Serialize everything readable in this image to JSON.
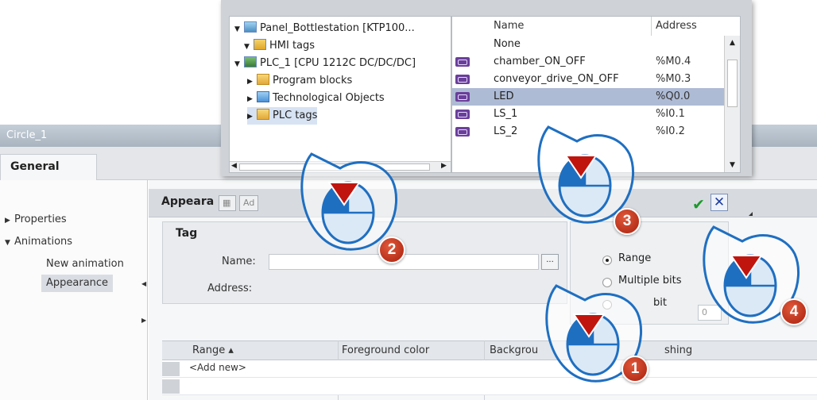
{
  "inspector": {
    "title": "Circle_1",
    "tab_general": "General",
    "nav": {
      "properties": "Properties",
      "animations": "Animations",
      "new_animation": "New animation",
      "appearance": "Appearance"
    },
    "content_title": "Appeara",
    "toolbar_add": "Ad",
    "tag_group": "Tag",
    "name_label": "Name:",
    "address_label": "Address:",
    "browse_label": "...",
    "type_options": {
      "range": "Range",
      "multiple_bits": "Multiple bits",
      "single_bit": "bit",
      "bit_value": "0"
    },
    "grid_headers": {
      "range": "Range ▴",
      "foreground": "Foreground color",
      "background": "Backgrou",
      "flashing": "shing"
    },
    "add_new": "<Add new>"
  },
  "popup": {
    "tree": [
      "Panel_Bottlestation [KTP100...",
      "HMI tags",
      "PLC_1 [CPU 1212C DC/DC/DC]",
      "Program blocks",
      "Technological Objects",
      "PLC tags"
    ],
    "col_name": "Name",
    "col_address": "Address",
    "rows": [
      {
        "name": "None",
        "address": ""
      },
      {
        "name": "chamber_ON_OFF",
        "address": "%M0.4"
      },
      {
        "name": "conveyor_drive_ON_OFF",
        "address": "%M0.3"
      },
      {
        "name": "LED",
        "address": "%Q0.0"
      },
      {
        "name": "LS_1",
        "address": "%I0.1"
      },
      {
        "name": "LS_2",
        "address": "%I0.2"
      }
    ]
  },
  "callouts": {
    "one": "1",
    "two": "2",
    "three": "3",
    "four": "4"
  },
  "colors": {
    "accent": "#a81f0c",
    "selection": "#aebbd5",
    "callout_fill": "#1f6fc1"
  }
}
